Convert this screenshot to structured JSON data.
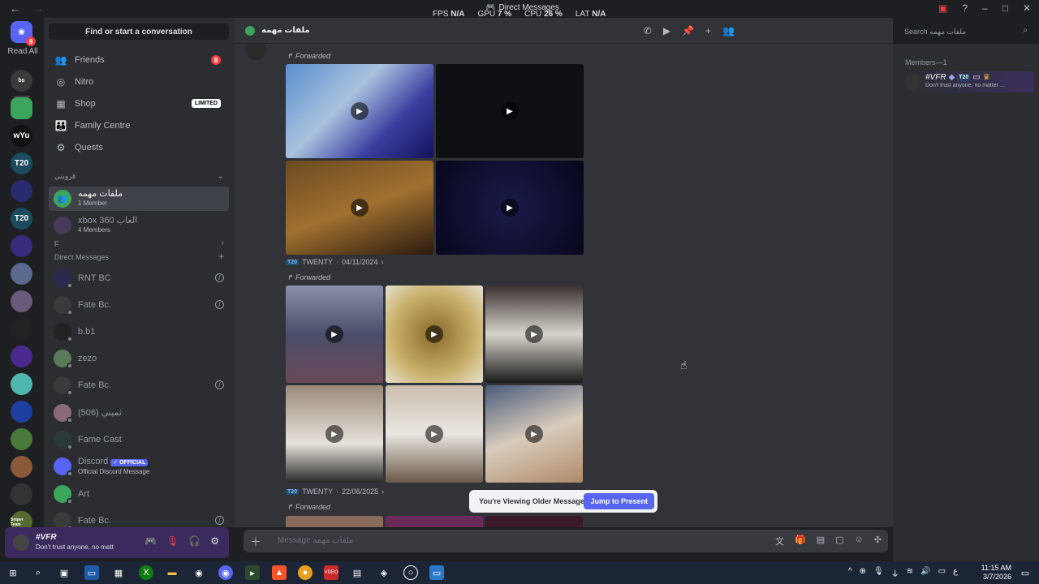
{
  "titlebar": {
    "title": "Direct Messages",
    "stats": [
      {
        "key": "FPS",
        "value": "N/A"
      },
      {
        "key": "GPU",
        "value": "7 %"
      },
      {
        "key": "CPU",
        "value": "26 %"
      },
      {
        "key": "LAT",
        "value": "N/A"
      }
    ]
  },
  "rail": {
    "read_all": "Read All",
    "home_badge": "8",
    "servers": [
      {
        "label": "bs",
        "color": "#3a3a3a"
      },
      {
        "label": "",
        "color": "#3ba55c"
      },
      {
        "label": "wYu",
        "color": "#111111"
      },
      {
        "label": "T20",
        "color": "#1a4b5e"
      },
      {
        "label": "",
        "color": "#2a2a6e"
      },
      {
        "label": "T20",
        "color": "#1a4b5e"
      },
      {
        "label": "",
        "color": "#3a2a7e"
      },
      {
        "label": "",
        "color": "#5a6a8e"
      },
      {
        "label": "",
        "color": "#6a5a7a"
      },
      {
        "label": "",
        "color": "#222222"
      },
      {
        "label": "",
        "color": "#4a2a8e"
      },
      {
        "label": "",
        "color": "#4fb6b0"
      },
      {
        "label": "",
        "color": "#1f3fa0"
      },
      {
        "label": "",
        "color": "#4a7a3a"
      },
      {
        "label": "",
        "color": "#8a5a3a"
      },
      {
        "label": "",
        "color": "#333333"
      },
      {
        "label": "Sniper Team",
        "color": "#556b2f"
      }
    ]
  },
  "sidebar": {
    "search_label": "Find or start a conversation",
    "nav": [
      {
        "label": "Friends",
        "icon": "friends-icon",
        "glyph": "👥",
        "badge": "8"
      },
      {
        "label": "Nitro",
        "icon": "nitro-icon",
        "glyph": "◎"
      },
      {
        "label": "Shop",
        "icon": "shop-icon",
        "glyph": "▦",
        "tag": "LIMITED"
      },
      {
        "label": "Family Centre",
        "icon": "family-icon",
        "glyph": "👪"
      },
      {
        "label": "Quests",
        "icon": "quests-icon",
        "glyph": "⚙"
      }
    ],
    "folder_label": "قروبتي",
    "groups": [
      {
        "name": "ملفات مهمه",
        "sub": "1 Member",
        "color": "#3ba55c",
        "active": true
      },
      {
        "name": "xbox 360 العاب",
        "sub": "4 Members",
        "color": "#4a3a5a",
        "active": false
      }
    ],
    "folder2_label": "F",
    "dm_label": "Direct Messages",
    "dms": [
      {
        "name": "RNT BC",
        "color": "#2a2a4e",
        "closable": true
      },
      {
        "name": "Fate Bc.",
        "color": "#3a3a3a",
        "closable": true
      },
      {
        "name": "b.b1",
        "color": "#222222",
        "closable": false
      },
      {
        "name": "zezo",
        "color": "#5a7a5a",
        "closable": false
      },
      {
        "name": "Fate Bc.",
        "color": "#3a3a3a",
        "closable": true
      },
      {
        "name": "(506) ثميني",
        "color": "#8a6a7a",
        "closable": false
      },
      {
        "name": "Fame Cast",
        "color": "#2a3a3a",
        "closable": false
      },
      {
        "name": "Discord",
        "sub": "Official Discord Message",
        "official": "✓ OFFICIAL",
        "color": "#5865f2",
        "closable": false
      },
      {
        "name": "Art",
        "color": "#3ba55c",
        "closable": false
      },
      {
        "name": "Fate Bc.",
        "color": "#3a3a3a",
        "closable": true
      }
    ]
  },
  "user_panel": {
    "name": "#VFR",
    "status": "Don't trust anyone, no matt"
  },
  "chat_header": {
    "title": "ملفات مهمه"
  },
  "top_search": {
    "placeholder": "Search ملفات مهمه"
  },
  "chat": {
    "forwarded_label": "Forwarded",
    "messages": [
      {
        "sender": "TWENTY",
        "date": "04/11/2024"
      },
      {
        "sender": "TWENTY",
        "date": "22/06/2025"
      }
    ],
    "older_text": "You're Viewing Older Messages",
    "jump_label": "Jump to Present"
  },
  "composer": {
    "placeholder": "Message ملفات مهمه"
  },
  "members": {
    "title": "Members—1",
    "list": [
      {
        "name": "#VFR",
        "tag": "T20",
        "status": "Don't trust anyone, no matter ..."
      }
    ]
  },
  "taskbar": {
    "time": "11:15 AM",
    "date": "3/7/2026",
    "lang": "ع"
  }
}
